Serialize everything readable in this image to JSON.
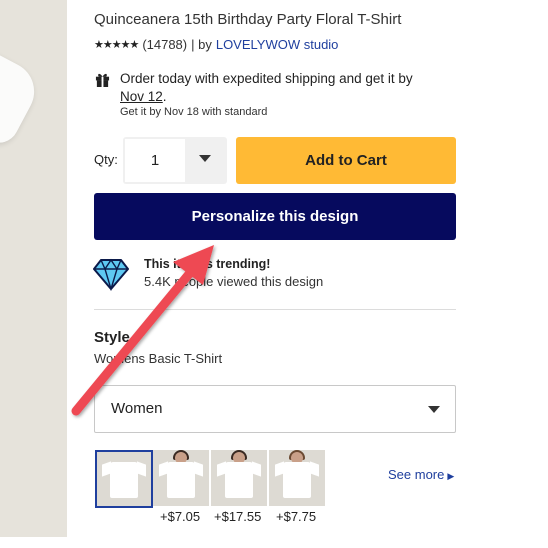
{
  "product": {
    "title": "Quinceanera 15th Birthday Party Floral T-Shirt",
    "stars": "★★★★★",
    "review_count": "(14788)",
    "by_text": "| by",
    "seller": "LOVELYWOW studio"
  },
  "shipping": {
    "line1": "Order today with expedited shipping and get it by",
    "date": "Nov 12",
    "period": ".",
    "standard": "Get it by Nov 18 with standard"
  },
  "purchase": {
    "qty_label": "Qty:",
    "qty_value": "1",
    "add_to_cart": "Add to Cart",
    "personalize": "Personalize this design"
  },
  "trending": {
    "title": "This item is trending!",
    "views": "5.4K people viewed this design"
  },
  "style": {
    "heading": "Style",
    "value": "Womens Basic T-Shirt",
    "dropdown_selected": "Women",
    "thumbnails": [
      {
        "price": ""
      },
      {
        "price": "+$7.05"
      },
      {
        "price": "+$17.55"
      },
      {
        "price": "+$7.75"
      }
    ],
    "see_more": "See more"
  },
  "colors": {
    "accent": "#ffba35",
    "primary": "#060a5e",
    "link": "#1f3f9e",
    "annotation_arrow": "#ee4a52"
  },
  "icons": [
    "gift-icon",
    "diamond-icon",
    "chevron-down-icon",
    "chevron-right-icon"
  ]
}
